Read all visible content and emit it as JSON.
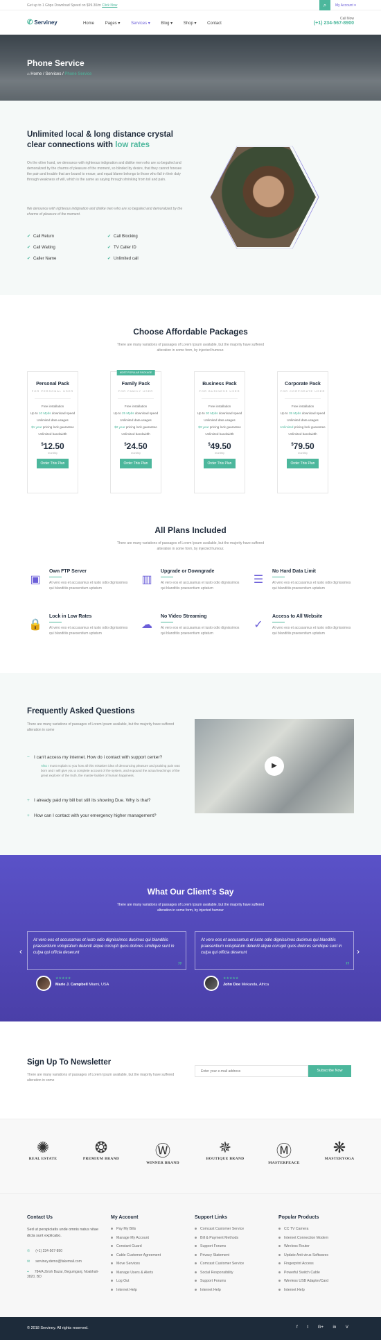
{
  "topbar": {
    "promo": "Get up to 1 Gbps Download Speed on $99.30/m",
    "promo_link": "Click Now",
    "account": "My Account ▾",
    "search_icon": "search-icon"
  },
  "nav": {
    "brand": "Serviney",
    "items": [
      "Home",
      "Pages ▾",
      "Services ▾",
      "Blog ▾",
      "Shop ▾",
      "Contact"
    ],
    "active_index": 2,
    "call_label": "Call Now",
    "call_number": "(+1) 234-567-8900"
  },
  "hero": {
    "title": "Phone Service",
    "crumbs": [
      "Home",
      "Services",
      "Phone Service"
    ]
  },
  "intro": {
    "heading": "Unlimited local & long distance crystal clear connections with",
    "heading_accent": "low rates",
    "paragraph": "On the other hand, we denounce with righteous indignation and dislike men who are so beguiled and demoralized by the charms of pleasure of the moment, so blinded by desire, that they cannot foresee the pain and trouble that are bound to ensue; and equal blame belongs to those who fail in their duty through weakness of will, which is the same as saying through shrinking from toil and pain.",
    "italic": "We denounce with righteous indignation and dislike men who are so beguiled and demoralized by the charms of pleasure of the moment.",
    "features": [
      "Call Return",
      "Call Blocking",
      "Call Waiting",
      "TV Caller ID",
      "Caller Name",
      "Unlimited call"
    ]
  },
  "packages": {
    "title": "Choose Affordable Packages",
    "subtitle": "There are many variations of passages of Lorem Ipsum available, but the majority have suffered alteration in some form, by injected humour.",
    "plans": [
      {
        "name": "Personal Pack",
        "sub": "FOR PERSONAL USER",
        "badge": "",
        "install": "Free installation",
        "speed_pre": "Up to ",
        "speed": "10 Mpbs",
        "speed_post": " download speed",
        "data": "Unlimited data usages",
        "guar": "$1 year",
        "guar_post": " pricing lock guarantee",
        "bw": "Unlimited bandwidth",
        "price": "12.50",
        "per": "monthly",
        "btn": "Order This Plan"
      },
      {
        "name": "Family Pack",
        "sub": "FOR FAMILY USER",
        "badge": "MOST POPULAR PACKAGE",
        "install": "Free installation",
        "speed_pre": "Up to ",
        "speed": "25 Mpbs",
        "speed_post": " download speed",
        "data": "Unlimited data usages",
        "guar": "$2 year",
        "guar_post": " pricing lock guarantee",
        "bw": "Unlimited bandwidth",
        "price": "24.50",
        "per": "monthly",
        "btn": "Order This Plan"
      },
      {
        "name": "Business Pack",
        "sub": "FOR BUSINESS USER",
        "badge": "",
        "install": "Free installation",
        "speed_pre": "Up to ",
        "speed": "30 Mpbs",
        "speed_post": " download speed",
        "data": "Unlimited data usages",
        "guar": "$3 year",
        "guar_post": " pricing lock guarantee",
        "bw": "Unlimited bandwidth",
        "price": "49.50",
        "per": "monthly",
        "btn": "Order This Plan"
      },
      {
        "name": "Corporate Pack",
        "sub": "FOR CORPORATE USER",
        "badge": "",
        "install": "Free installation",
        "speed_pre": "Up to ",
        "speed": "35 Mpbs",
        "speed_post": " download speed",
        "data": "Unlimited data usages",
        "guar": "Unlimited",
        "guar_post": " pricing lock guarantee",
        "bw": "Unlimited bandwidth",
        "price": "79.50",
        "per": "monthly",
        "btn": "Order This Plan"
      }
    ]
  },
  "included": {
    "title": "All Plans Included",
    "subtitle": "There are many variations of passages of Lorem Ipsum available, but the majority have suffered alteration in some form, by injected humour.",
    "items": [
      {
        "title": "Own FTP Server",
        "icon": "server-icon",
        "glyph": "▣",
        "text": "At vero eos et accusamus et iusto odio dignissimos qui blanditiis praesentium uptatum"
      },
      {
        "title": "Upgrade or Downgrade",
        "icon": "chart-icon",
        "glyph": "▥",
        "text": "At vero eos et accusamus et iusto odio dignissimos qui blanditiis praesentium uptatum"
      },
      {
        "title": "No Hard Data Limit",
        "icon": "database-icon",
        "glyph": "☰",
        "text": "At vero eos et accusamus et iusto odio dignissimos qui blanditiis praesentium uptatum"
      },
      {
        "title": "Lock in Low Rates",
        "icon": "lock-icon",
        "glyph": "🔒",
        "text": "At vero eos et accusamus et iusto odio dignissimos qui blanditiis praesentium uptatum"
      },
      {
        "title": "No Video Streaming",
        "icon": "cloud-icon",
        "glyph": "☁",
        "text": "At vero eos et accusamus et iusto odio dignissimos qui blanditiis praesentium uptatum"
      },
      {
        "title": "Access to All Website",
        "icon": "check-circle-icon",
        "glyph": "✓",
        "text": "At vero eos et accusamus et iusto odio dignissimos qui blanditiis praesentium uptatum"
      }
    ]
  },
  "faq": {
    "title": "Frequently Asked Questions",
    "subtitle": "There are many variations of passages of Lorem Ipsum available, but the majority have suffered alteration in some",
    "items": [
      {
        "q": "I can't access my internet. How do i contact with support center?",
        "open": true,
        "sign": "−"
      },
      {
        "q": "I already paid my bill but still its showing Due. Why is that?",
        "open": false,
        "sign": "+"
      },
      {
        "q": "How can I contact with your emergency higher management?",
        "open": false,
        "sign": "+"
      }
    ],
    "answer_accent": "Also I",
    "answer": " must explain to you how all this mistaken idea of denouncing pleasure and praising pain was born and I will give you a complete account of the system, and expound the actual teachings of the great explorer of the truth, the master-builder of human happiness."
  },
  "testimonials": {
    "title": "What Our Client's Say",
    "subtitle": "There are many variations of passages of Lorem Ipsum available, but the majority have suffered alteration in some form, by injected humour",
    "items": [
      {
        "quote": "At vero eos et accusamus et iusto odio dignissimos ducimus qui blanditiis praesentium voluptatum deleniti atque corrupti quos dolores similique sunt in culpa qui officia deserunt",
        "name": "Marie J. Campbell",
        "loc": "Miami, USA",
        "stars": "★★★★★"
      },
      {
        "quote": "At vero eos et accusamus et iusto odio dignissimos ducimus qui blanditiis praesentium voluptatum deleniti atque corrupti quos dolores similique sunt in culpa qui officia deserunt",
        "name": "John Doe",
        "loc": "Mekanda, Africa",
        "stars": "★★★★★"
      }
    ]
  },
  "newsletter": {
    "title": "Sign Up To Newsletter",
    "text": "There are many variations of passages of Lorem Ipsum available, but the majority have suffered alteration in some",
    "placeholder": "Enter your e-mail address",
    "button": "Subscribe Now"
  },
  "brands": [
    {
      "name": "REAL ESTATE",
      "sub": "",
      "glyph": "✺"
    },
    {
      "name": "PREMIUM BRAND",
      "sub": "",
      "glyph": "❂"
    },
    {
      "name": "WINNER BRAND",
      "sub": "",
      "glyph": "Ⓦ"
    },
    {
      "name": "BOUTIQUE BRAND",
      "sub": "",
      "glyph": "✵"
    },
    {
      "name": "MASTERPEACE",
      "sub": "",
      "glyph": "Ⓜ"
    },
    {
      "name": "MASTERYOGA",
      "sub": "",
      "glyph": "❋"
    }
  ],
  "footer": {
    "contact_title": "Contact Us",
    "contact_text": "Sed ut perspiciatis unde omnis natus vitae dicta sunt explicabo.",
    "phone": "(+1) 234-567-890",
    "email": "serviney.demo@fakemail.com",
    "address": "784/A Zirish Bazar, Begumganj, Noakhali-3820, BD",
    "cols": [
      {
        "title": "My Account",
        "items": [
          "Pay My Bills",
          "Manage My Account",
          "Constant Guard",
          "Cable Customer Agreement",
          "Move Services",
          "Manage Users & Alerts",
          "Log Out",
          "Internet Help"
        ]
      },
      {
        "title": "Support Links",
        "items": [
          "Comcast Customer Service",
          "Bill & Payment Methods",
          "Support Forums",
          "Privacy Statement",
          "Comcast Customer Service",
          "Social Responsibility",
          "Support Forums",
          "Internet Help"
        ]
      },
      {
        "title": "Popular Products",
        "items": [
          "CC TV Camera",
          "Internet Connection Modem",
          "Wireless Router",
          "Update Anti-virus Softwares",
          "Fingerprint Access",
          "Powerful Switch Cable",
          "Wireless USB Adapter/Card",
          "Internet Help"
        ]
      }
    ],
    "copyright": "© 2018 Serviney. All rights reserved.",
    "social": [
      "f",
      "t",
      "G+",
      "in",
      "V"
    ]
  },
  "colors": {
    "accent": "#4cb79c",
    "purple": "#6b5ed8",
    "navy": "#1e2a3a"
  }
}
